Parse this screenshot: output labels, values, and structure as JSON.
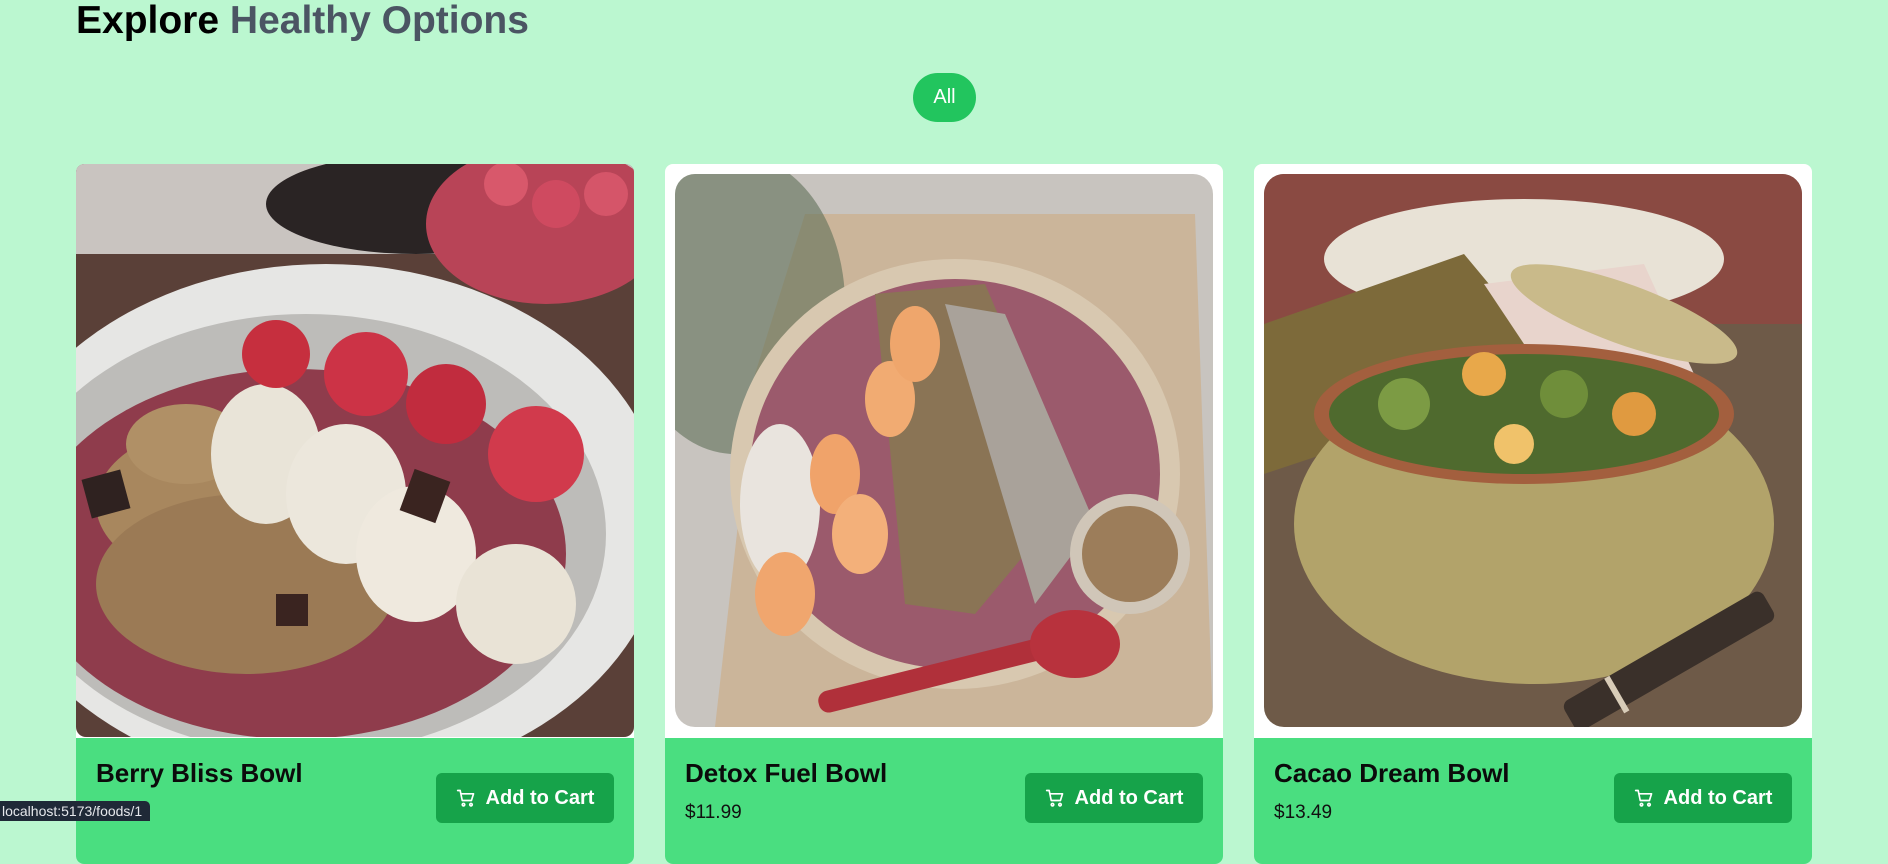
{
  "header": {
    "title_primary": "Explore",
    "title_secondary": "Healthy Options"
  },
  "filters": [
    {
      "label": "All",
      "active": true
    }
  ],
  "foods": [
    {
      "name": "Berry Bliss Bowl",
      "price": "",
      "add_to_cart_label": "Add to Cart",
      "image": "acai bowl with raspberries, banana and granola"
    },
    {
      "name": "Detox Fuel Bowl",
      "price": "$11.99",
      "add_to_cart_label": "Add to Cart",
      "image": "smoothie bowl with peach slices, coconut and granola"
    },
    {
      "name": "Cacao Dream Bowl",
      "price": "$13.49",
      "add_to_cart_label": "Add to Cart",
      "image": "ceramic pot with roasted sprouts and squash"
    }
  ],
  "status_bar": {
    "url": "localhost:5173/foods/1"
  },
  "colors": {
    "page_background": "#bbf7d0",
    "accent_green": "#22c55e",
    "card_footer": "#4ade80",
    "button_green": "#16a34a"
  }
}
